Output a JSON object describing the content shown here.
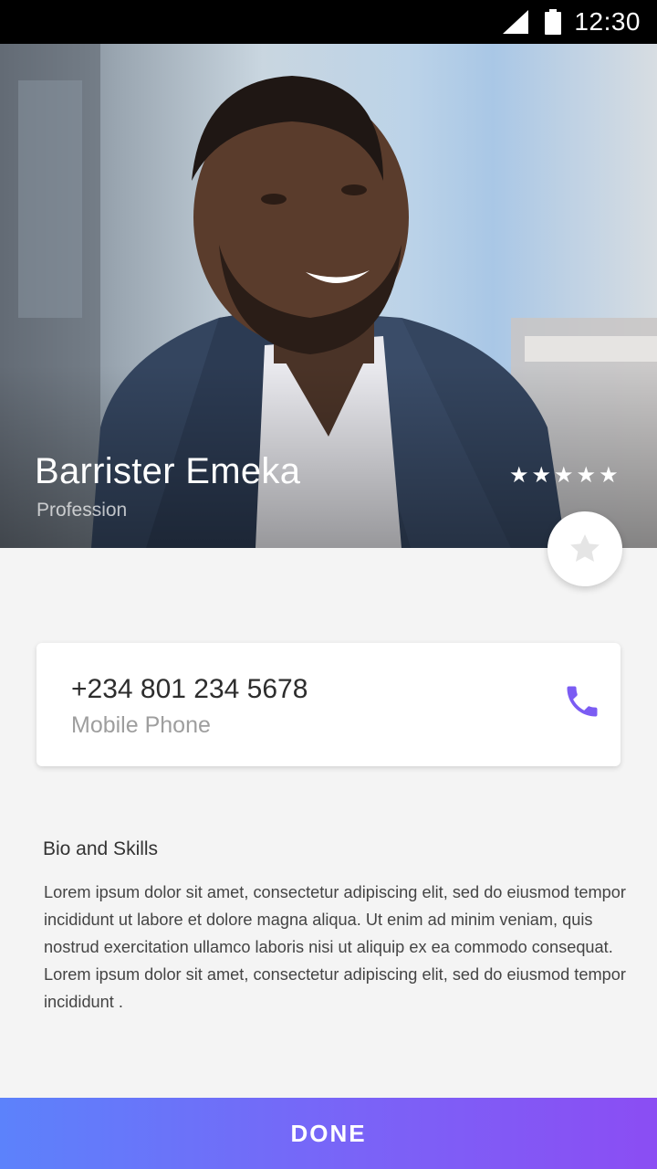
{
  "status_bar": {
    "time": "12:30",
    "icons": [
      "signal-icon",
      "battery-icon"
    ]
  },
  "profile": {
    "name": "Barrister Emeka",
    "profession": "Profession",
    "rating": 5,
    "rating_max": 5,
    "photo": "profile-photo"
  },
  "favorite_button": {
    "icon": "star-icon"
  },
  "contact": {
    "phone_number": "+234 801 234 5678",
    "phone_label": "Mobile Phone",
    "icon": "phone-icon",
    "accent": "#7b5cf3"
  },
  "bio": {
    "title": "Bio and Skills",
    "text": "Lorem ipsum dolor sit amet, consectetur adipiscing elit, sed do eiusmod tempor incididunt ut labore et dolore magna aliqua. Ut enim ad minim veniam, quis nostrud exercitation ullamco laboris nisi ut aliquip ex ea commodo consequat. Lorem ipsum dolor sit amet, consectetur adipiscing elit, sed do eiusmod tempor incididunt ."
  },
  "actions": {
    "done_label": "DONE",
    "gradient": [
      "#5c82fb",
      "#8b4df3"
    ]
  }
}
